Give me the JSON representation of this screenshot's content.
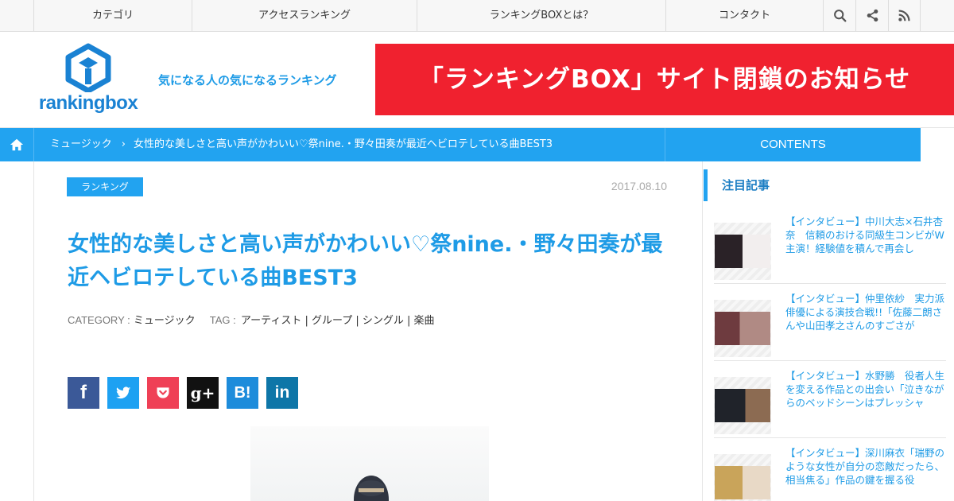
{
  "topnav": {
    "items": [
      "カテゴリ",
      "アクセスランキング",
      "ランキングBOXとは？",
      "コンタクト"
    ],
    "icons": [
      "search-icon",
      "share-icon",
      "rss-icon"
    ]
  },
  "header": {
    "logo_text": "rankingbox",
    "tagline": "気になる人の気になるランキング",
    "banner": "「ランキングBOX」サイト閉鎖のお知らせ"
  },
  "breadcrumb": {
    "items": [
      "ミュージック",
      "女性的な美しさと高い声がかわいい♡祭nine.・野々田奏が最近ヘビロテしている曲BEST3"
    ],
    "contents_tab": "CONTENTS"
  },
  "article": {
    "category_badge": "ランキング",
    "date": "2017.08.10",
    "title": "女性的な美しさと高い声がかわいい♡祭nine.・野々田奏が最近ヘビロテしている曲BEST3",
    "category_label": "CATEGORY :",
    "category_value": "ミュージック",
    "tag_label": "TAG :",
    "tags": "アーティスト | グループ | シングル | 楽曲"
  },
  "share": [
    {
      "label": "f",
      "color": "#3b5998"
    },
    {
      "label": "t",
      "color": "#1da1f2"
    },
    {
      "label": "p",
      "color": "#ef4056"
    },
    {
      "label": "g+",
      "color": "#111111"
    },
    {
      "label": "B!",
      "color": "#1d8cdb"
    },
    {
      "label": "in",
      "color": "#0e76a8"
    }
  ],
  "sidebar": {
    "heading": "注目記事",
    "items": [
      {
        "text": "【インタビュー】中川大志×石井杏奈　信頼のおける同級生コンビがW主演！経験値を積んで再会し"
      },
      {
        "text": "【インタビュー】仲里依紗　実力派俳優による演技合戦!!「佐藤二朗さんや山田孝之さんのすごさが"
      },
      {
        "text": "【インタビュー】水野勝　役者人生を変える作品との出会い「泣きながらのベッドシーンはプレッシャ"
      },
      {
        "text": "【インタビュー】深川麻衣「瑞野のような女性が自分の恋敵だったら、相当焦る」作品の鍵を握る役"
      }
    ]
  },
  "colors": {
    "accent": "#22a3f0",
    "title_blue": "#1e9be6",
    "banner_red": "#f0212f"
  }
}
